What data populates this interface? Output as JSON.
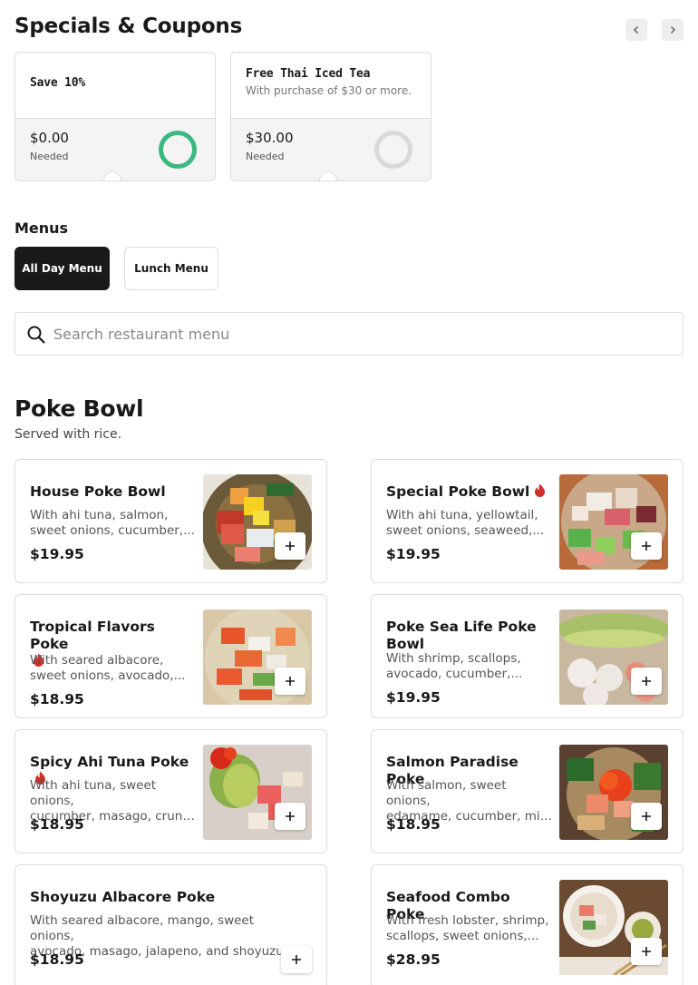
{
  "header": {
    "title": "Specials & Coupons",
    "prev_icon": "chevron-left-icon",
    "next_icon": "chevron-right-icon"
  },
  "coupons": [
    {
      "name": "Save 10%",
      "description": "",
      "amount": "$0.00",
      "needed_label": "Needed",
      "progress": 1.0,
      "ring_color": "#3bb87f"
    },
    {
      "name": "Free Thai Iced Tea",
      "description": "With purchase of $30 or more.",
      "amount": "$30.00",
      "needed_label": "Needed",
      "progress": 0.0,
      "ring_color": "#d9d9d9"
    }
  ],
  "menus": {
    "label": "Menus",
    "tabs": [
      {
        "label": "All Day Menu",
        "selected": true
      },
      {
        "label": "Lunch Menu",
        "selected": false
      }
    ]
  },
  "search": {
    "placeholder": "Search restaurant menu",
    "value": "",
    "icon": "search-icon"
  },
  "section": {
    "title": "Poke Bowl",
    "subtitle": "Served with rice."
  },
  "items": [
    {
      "name": "House Poke Bowl",
      "spicy": false,
      "desc_line1": "With ahi tuna, salmon,",
      "desc_line2": "sweet onions, cucumber,...",
      "price": "$19.95"
    },
    {
      "name": "Special Poke Bowl",
      "spicy": true,
      "desc_line1": "With ahi tuna, yellowtail,",
      "desc_line2": "sweet onions, seaweed,...",
      "price": "$19.95"
    },
    {
      "name": "Tropical Flavors Poke",
      "spicy": true,
      "desc_line1": "With seared albacore,",
      "desc_line2": "sweet onions, avocado,...",
      "price": "$18.95"
    },
    {
      "name": "Poke Sea Life Poke Bowl",
      "spicy": false,
      "desc_line1": "With shrimp, scallops,",
      "desc_line2": "avocado, cucumber,...",
      "price": "$19.95"
    },
    {
      "name": "Spicy Ahi Tuna Poke",
      "spicy": true,
      "desc_line1": "With ahi tuna, sweet onions,",
      "desc_line2": "cucumber, masago, crunch...",
      "price": "$18.95"
    },
    {
      "name": "Salmon Paradise Poke",
      "spicy": false,
      "desc_line1": "With salmon, sweet onions,",
      "desc_line2": "edamame, cucumber, mint...",
      "price": "$18.95"
    },
    {
      "name": "Shoyuzu Albacore Poke",
      "spicy": false,
      "desc_line1": "With seared albacore, mango, sweet onions,",
      "desc_line2": "avocado, masago, jalapeno, and shoyuzu.",
      "price": "$18.95"
    },
    {
      "name": "Seafood Combo Poke",
      "spicy": false,
      "desc_line1": "With fresh lobster, shrimp,",
      "desc_line2": "scallops, sweet onions,...",
      "price": "$28.95"
    }
  ],
  "icons": {
    "spicy": "flame-icon",
    "add": "plus-icon"
  },
  "colors": {
    "accent_dark": "#191919",
    "progress_complete": "#3bb87f",
    "spicy": "#d0312d"
  }
}
